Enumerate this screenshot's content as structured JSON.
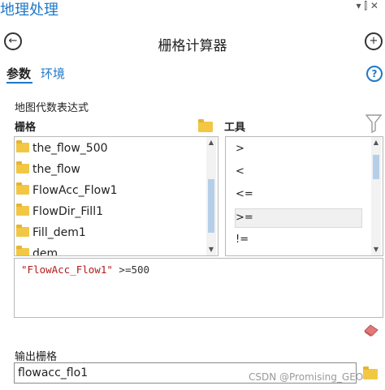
{
  "header": {
    "pane_title": "地理处理",
    "pin_icons": "▾ ⫿ ✕",
    "tool_title": "栅格计算器"
  },
  "tabs": [
    {
      "label": "参数",
      "active": true
    },
    {
      "label": "环境",
      "active": false
    }
  ],
  "expression_section": {
    "label": "地图代数表达式",
    "rasters_label": "栅格",
    "tools_label": "工具"
  },
  "rasters": [
    "the_flow_500",
    "the_flow",
    "FlowAcc_Flow1",
    "FlowDir_Fill1",
    "Fill_dem1",
    "dem"
  ],
  "operators": [
    ">",
    "<",
    "<=",
    ">=",
    "!="
  ],
  "selected_operator": ">=",
  "expression": {
    "raster_ref": "\"FlowAcc_Flow1\"",
    "rest": " >=500"
  },
  "output": {
    "label": "输出栅格",
    "value": "flowacc_flo1"
  },
  "watermark": "CSDN @Promising_GEO",
  "colors": {
    "accent": "#1f78c8",
    "folder": "#f2c744",
    "expression_string": "#b01c1c",
    "eraser": "#e07a7a"
  }
}
